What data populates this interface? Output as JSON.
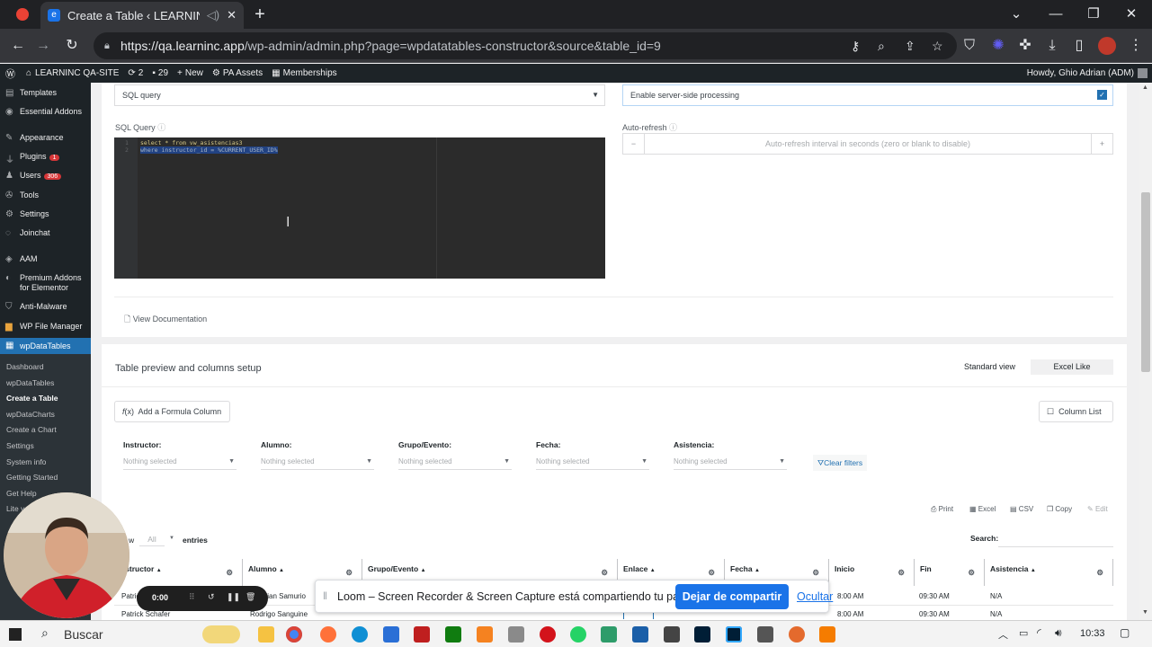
{
  "browser": {
    "tab_title": "Create a Table ‹ LEARNINC Q",
    "url_host": "https://qa.learninc.app",
    "url_path": "/wp-admin/admin.php?page=wpdatatables-constructor&source&table_id=9"
  },
  "adminbar": {
    "site": "LEARNINC QA-SITE",
    "updates": "2",
    "comments": "29",
    "new": "New",
    "pa_assets": "PA Assets",
    "memberships": "Memberships",
    "howdy": "Howdy, Ghio Adrian (ADM)"
  },
  "sidebar": {
    "items": [
      {
        "label": "Templates"
      },
      {
        "label": "Essential Addons"
      },
      {
        "label": "Appearance"
      },
      {
        "label": "Plugins",
        "badge": "1"
      },
      {
        "label": "Users",
        "badge": "306"
      },
      {
        "label": "Tools"
      },
      {
        "label": "Settings"
      },
      {
        "label": "Joinchat"
      },
      {
        "label": "AAM"
      },
      {
        "label": "Premium Addons for Elementor"
      },
      {
        "label": "Anti-Malware"
      },
      {
        "label": "WP File Manager"
      },
      {
        "label": "wpDataTables"
      }
    ],
    "submenu": [
      "Dashboard",
      "wpDataTables",
      "Create a Table",
      "wpDataCharts",
      "Create a Chart",
      "Settings",
      "System info",
      "Getting Started",
      "Get Help",
      "Lite vs"
    ]
  },
  "editor_section": {
    "source_select": "SQL query",
    "server_side_label": "Enable server-side processing",
    "sql_label": "SQL Query",
    "code_lines": [
      "select * from vw_asistencias3",
      "where instructor_id = %CURRENT_USER_ID%"
    ],
    "autorefresh_label": "Auto-refresh",
    "autorefresh_placeholder": "Auto-refresh interval in seconds (zero or blank to disable)",
    "minus": "−",
    "plus": "+",
    "view_docs": "View Documentation"
  },
  "preview": {
    "title": "Table preview and columns setup",
    "standard_view": "Standard view",
    "excel_like": "Excel Like",
    "add_formula": "Add a Formula Column",
    "column_list": "Column List",
    "filters": [
      {
        "label": "Instructor:",
        "value": "Nothing selected"
      },
      {
        "label": "Alumno:",
        "value": "Nothing selected"
      },
      {
        "label": "Grupo/Evento:",
        "value": "Nothing selected"
      },
      {
        "label": "Fecha:",
        "value": "Nothing selected"
      },
      {
        "label": "Asistencia:",
        "value": "Nothing selected"
      }
    ],
    "clear_filters": "Clear filters",
    "export": [
      "Print",
      "Excel",
      "CSV",
      "Copy",
      "Edit"
    ],
    "show_prefix": "w",
    "show_value": "All",
    "entries": "entries",
    "search_label": "Search:",
    "columns": [
      "nstructor",
      "Alumno",
      "Grupo/Evento",
      "Enlace",
      "Fecha",
      "Inicio",
      "Fin",
      "Asistencia"
    ],
    "rows": [
      {
        "instructor": "Patric",
        "alumno": "tian Samurio",
        "inicio": "8:00 AM",
        "fin": "09:30 AM",
        "asistencia": "N/A"
      },
      {
        "instructor": "Patrick Schafer",
        "alumno": "Rodrigo Sanguine",
        "inicio": "8:00 AM",
        "fin": "09:30 AM",
        "asistencia": "N/A"
      }
    ]
  },
  "recorder": {
    "time": "0:00"
  },
  "loom": {
    "message": "Loom – Screen Recorder & Screen Capture está compartiendo tu pantalla.",
    "stop": "Dejar de compartir",
    "hide": "Ocultar"
  },
  "taskbar": {
    "search": "Buscar",
    "time": "10:33"
  }
}
